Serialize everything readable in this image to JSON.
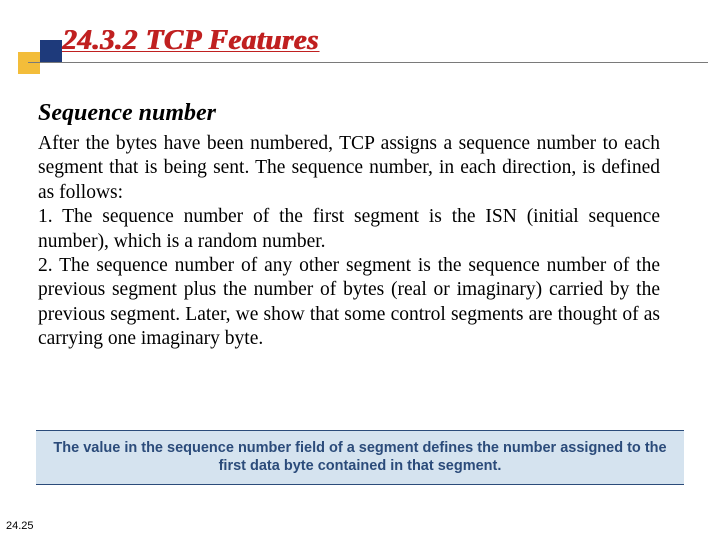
{
  "title": "24.3.2  TCP Features",
  "subtitle": "Sequence number",
  "body": {
    "intro": "After the bytes have been numbered, TCP assigns a sequence number to each segment that is being sent. The sequence number, in each direction, is defined as follows:",
    "point1": "1. The sequence number of the first segment is the ISN (initial sequence number), which is a random number.",
    "point2": "2. The sequence number of any other segment is the sequence number of the previous segment plus the number of bytes (real or imaginary) carried by the previous segment. Later, we show that some control segments are thought of as carrying one imaginary byte."
  },
  "callout": "The value in the sequence number field of a segment defines the number assigned to the first data byte contained in that segment.",
  "page_number": "24.25"
}
